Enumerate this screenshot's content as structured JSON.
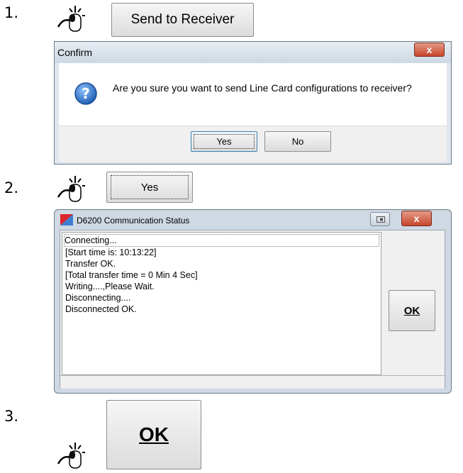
{
  "steps": [
    "1.",
    "2.",
    "3."
  ],
  "step1": {
    "send_button": "Send to Receiver",
    "send_button_accel": "t"
  },
  "confirm": {
    "title": "Confirm",
    "close": "x",
    "message": "Are you sure you want to send Line Card configurations to receiver?",
    "yes": "Yes",
    "no": "No"
  },
  "step2": {
    "yes_button": "Yes"
  },
  "status": {
    "title": "D6200 Communication Status",
    "close": "x",
    "log": [
      "Connecting...",
      "[Start time is: 10:13:22]",
      "Transfer OK.",
      "[Total transfer time = 0 Min 4 Sec]",
      "Writing....,Please Wait.",
      "Disconnecting....",
      "Disconnected OK."
    ],
    "ok": "OK"
  },
  "step3": {
    "ok_button": "OK"
  },
  "icons": {
    "mouse": "mouse-click-icon",
    "question": "question-icon",
    "app": "d6200-app-icon"
  },
  "colors": {
    "close_red": "#c7462b",
    "question_blue": "#2d6fc1"
  }
}
